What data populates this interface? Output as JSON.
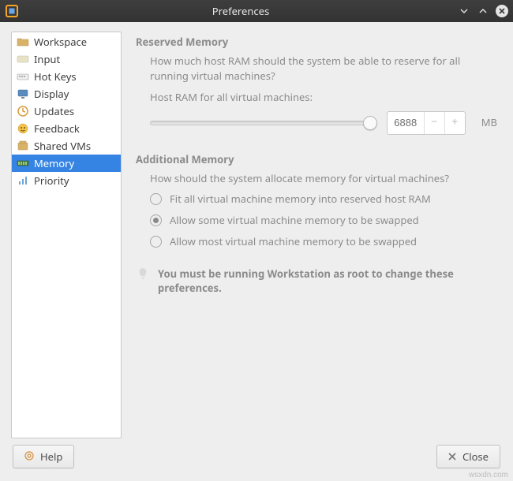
{
  "titlebar": {
    "title": "Preferences"
  },
  "sidebar": {
    "items": [
      {
        "label": "Workspace",
        "icon": "folder-icon",
        "selected": false
      },
      {
        "label": "Input",
        "icon": "input-icon",
        "selected": false
      },
      {
        "label": "Hot Keys",
        "icon": "keyboard-icon",
        "selected": false
      },
      {
        "label": "Display",
        "icon": "display-icon",
        "selected": false
      },
      {
        "label": "Updates",
        "icon": "updates-icon",
        "selected": false
      },
      {
        "label": "Feedback",
        "icon": "feedback-icon",
        "selected": false
      },
      {
        "label": "Shared VMs",
        "icon": "shared-icon",
        "selected": false
      },
      {
        "label": "Memory",
        "icon": "memory-icon",
        "selected": true
      },
      {
        "label": "Priority",
        "icon": "priority-icon",
        "selected": false
      }
    ]
  },
  "main": {
    "reserved": {
      "title": "Reserved Memory",
      "desc": "How much host RAM should the system be able to reserve for all running virtual machines?",
      "slider_label": "Host RAM for all virtual machines:",
      "value": "6888",
      "unit": "MB"
    },
    "additional": {
      "title": "Additional Memory",
      "desc": "How should the system allocate memory for virtual machines?",
      "options": [
        {
          "label": "Fit all virtual machine memory into reserved host RAM",
          "checked": false
        },
        {
          "label": "Allow some virtual machine memory to be swapped",
          "checked": true
        },
        {
          "label": "Allow most virtual machine memory to be swapped",
          "checked": false
        }
      ]
    },
    "tip": "You must be running Workstation as root to change these preferences."
  },
  "footer": {
    "help": "Help",
    "close": "Close"
  },
  "watermark": "wsxdn.com",
  "colors": {
    "selection": "#3584e4"
  }
}
